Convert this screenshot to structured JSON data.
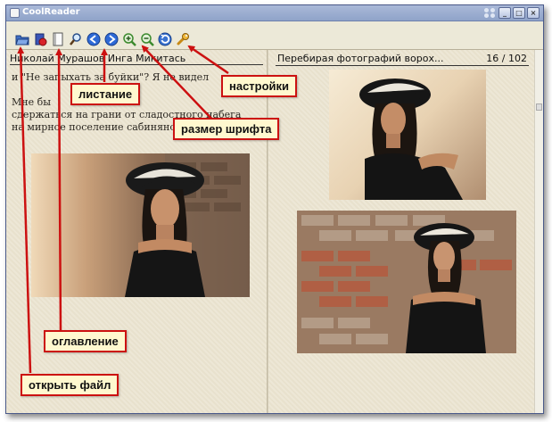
{
  "window": {
    "title": "CoolReader"
  },
  "toolbar": {
    "buttons": [
      {
        "name": "open-file",
        "icon": "folder-open-icon"
      },
      {
        "name": "recent",
        "icon": "recent-books-icon"
      },
      {
        "name": "toc",
        "icon": "book-icon"
      },
      {
        "name": "search",
        "icon": "search-icon"
      },
      {
        "name": "prev-page",
        "icon": "arrow-left-icon"
      },
      {
        "name": "next-page",
        "icon": "arrow-right-icon"
      },
      {
        "name": "zoom-in",
        "icon": "zoom-in-icon"
      },
      {
        "name": "zoom-out",
        "icon": "zoom-out-icon"
      },
      {
        "name": "rotate",
        "icon": "rotate-icon"
      },
      {
        "name": "settings",
        "icon": "wrench-icon"
      }
    ]
  },
  "left_page": {
    "header": "Николай Мурашов Инга Микитась",
    "lines": [
      "и \"Не запыхать за буйки\"? Я не видел",
      "",
      "Мне бы",
      "сдержаться на грани от сладостного набега",
      "на мирное поселение сабинянок."
    ]
  },
  "right_page": {
    "header": "Перебирая фотографий ворох...",
    "page_indicator": "16 / 102"
  },
  "annotations": {
    "settings": "настройки",
    "paging": "листание",
    "font_size": "размер шрифта",
    "toc": "оглавление",
    "open_file": "открыть файл"
  },
  "colors": {
    "annotation_border": "#cc1111",
    "annotation_bg": "#fff8cf",
    "arrow": "#cc1111"
  }
}
